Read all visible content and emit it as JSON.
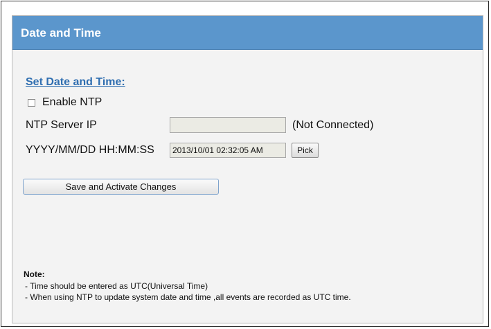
{
  "header": {
    "title": "Date and Time"
  },
  "section": {
    "title": "Set Date and Time:"
  },
  "ntp": {
    "enable_label": "Enable NTP",
    "enabled": false
  },
  "server": {
    "label": "NTP Server IP",
    "value": "",
    "status": "(Not Connected)"
  },
  "datetime": {
    "label": "YYYY/MM/DD HH:MM:SS",
    "value": "2013/10/01 02:32:05 AM",
    "pick_label": "Pick"
  },
  "actions": {
    "save_label": "Save and Activate Changes"
  },
  "note": {
    "title": "Note:",
    "lines": [
      "- Time should be entered as UTC(Universal Time)",
      "- When using NTP to update system date and time ,all events are recorded as UTC time."
    ]
  }
}
